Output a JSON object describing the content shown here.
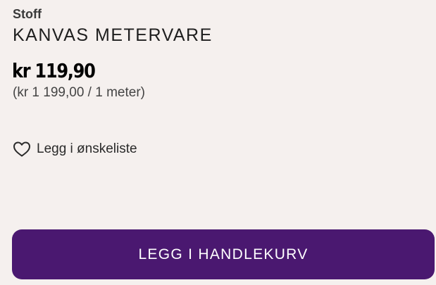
{
  "product": {
    "category": "Stoff",
    "title": "KANVAS METERVARE",
    "price": "kr 119,90",
    "unit_price": "(kr 1 199,00 / 1 meter)"
  },
  "wishlist": {
    "icon": "heart-outline-icon",
    "label": "Legg i ønskeliste"
  },
  "cart_button": {
    "label": "LEGG I HANDLEKURV"
  },
  "colors": {
    "background": "#f5f0ee",
    "button": "#4a1870",
    "button_text": "#ffffff"
  }
}
